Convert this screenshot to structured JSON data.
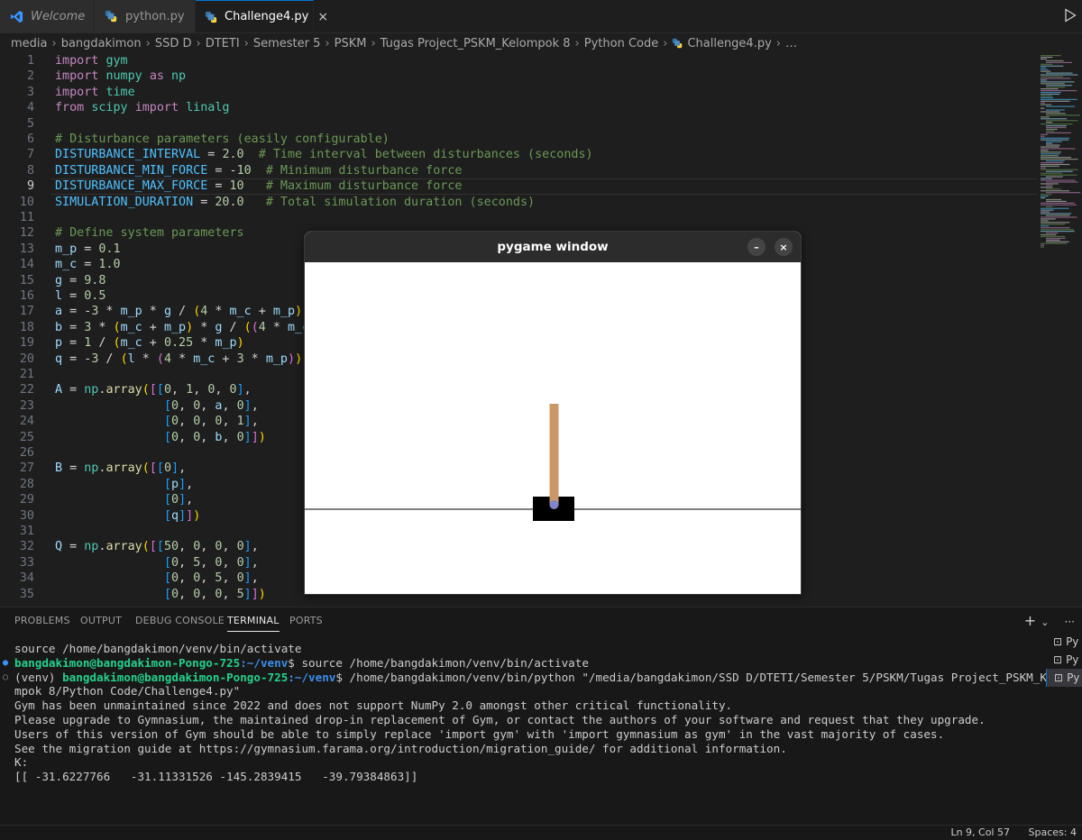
{
  "tabs": [
    {
      "label": "Welcome"
    },
    {
      "label": "python.py"
    },
    {
      "label": "Challenge4.py",
      "close": "×"
    }
  ],
  "breadcrumb": [
    "media",
    "bangdakimon",
    "SSD D",
    "DTETI",
    "Semester 5",
    "PSKM",
    "Tugas Project_PSKM_Kelompok 8",
    "Python Code",
    "Challenge4.py",
    "…"
  ],
  "code_lines": [
    {
      "n": "1"
    },
    {
      "n": "2"
    },
    {
      "n": "3"
    },
    {
      "n": "4"
    },
    {
      "n": "5"
    },
    {
      "n": "6"
    },
    {
      "n": "7"
    },
    {
      "n": "8"
    },
    {
      "n": "9"
    },
    {
      "n": "10"
    },
    {
      "n": "11"
    },
    {
      "n": "12"
    },
    {
      "n": "13"
    },
    {
      "n": "14"
    },
    {
      "n": "15"
    },
    {
      "n": "16"
    },
    {
      "n": "17"
    },
    {
      "n": "18"
    },
    {
      "n": "19"
    },
    {
      "n": "20"
    },
    {
      "n": "21"
    },
    {
      "n": "22"
    },
    {
      "n": "23"
    },
    {
      "n": "24"
    },
    {
      "n": "25"
    },
    {
      "n": "26"
    },
    {
      "n": "27"
    },
    {
      "n": "28"
    },
    {
      "n": "29"
    },
    {
      "n": "30"
    },
    {
      "n": "31"
    },
    {
      "n": "32"
    },
    {
      "n": "33"
    },
    {
      "n": "34"
    },
    {
      "n": "35"
    }
  ],
  "code": [
    [
      [
        "kw",
        "import"
      ],
      [
        "op",
        " "
      ],
      [
        "mod",
        "gym"
      ]
    ],
    [
      [
        "kw",
        "import"
      ],
      [
        "op",
        " "
      ],
      [
        "mod",
        "numpy"
      ],
      [
        "op",
        " "
      ],
      [
        "kw",
        "as"
      ],
      [
        "op",
        " "
      ],
      [
        "mod",
        "np"
      ]
    ],
    [
      [
        "kw",
        "import"
      ],
      [
        "op",
        " "
      ],
      [
        "mod",
        "time"
      ]
    ],
    [
      [
        "kw",
        "from"
      ],
      [
        "op",
        " "
      ],
      [
        "mod",
        "scipy"
      ],
      [
        "op",
        " "
      ],
      [
        "kw",
        "import"
      ],
      [
        "op",
        " "
      ],
      [
        "mod",
        "linalg"
      ]
    ],
    [],
    [
      [
        "cmt",
        "# Disturbance parameters (easily configurable)"
      ]
    ],
    [
      [
        "const",
        "DISTURBANCE_INTERVAL"
      ],
      [
        "op",
        " = "
      ],
      [
        "num",
        "2.0"
      ],
      [
        "op",
        "  "
      ],
      [
        "cmt",
        "# Time interval between disturbances (seconds)"
      ]
    ],
    [
      [
        "const",
        "DISTURBANCE_MIN_FORCE"
      ],
      [
        "op",
        " = -"
      ],
      [
        "num",
        "10"
      ],
      [
        "op",
        "  "
      ],
      [
        "cmt",
        "# Minimum disturbance force"
      ]
    ],
    [
      [
        "const",
        "DISTURBANCE_MAX_FORCE"
      ],
      [
        "op",
        " = "
      ],
      [
        "num",
        "10"
      ],
      [
        "op",
        "   "
      ],
      [
        "cmt",
        "# Maximum disturbance force"
      ]
    ],
    [
      [
        "const",
        "SIMULATION_DURATION"
      ],
      [
        "op",
        " = "
      ],
      [
        "num",
        "20.0"
      ],
      [
        "op",
        "   "
      ],
      [
        "cmt",
        "# Total simulation duration (seconds)"
      ]
    ],
    [],
    [
      [
        "cmt",
        "# Define system parameters"
      ]
    ],
    [
      [
        "var",
        "m_p"
      ],
      [
        "op",
        " = "
      ],
      [
        "num",
        "0.1"
      ]
    ],
    [
      [
        "var",
        "m_c"
      ],
      [
        "op",
        " = "
      ],
      [
        "num",
        "1.0"
      ]
    ],
    [
      [
        "var",
        "g"
      ],
      [
        "op",
        " = "
      ],
      [
        "num",
        "9.8"
      ]
    ],
    [
      [
        "var",
        "l"
      ],
      [
        "op",
        " = "
      ],
      [
        "num",
        "0.5"
      ]
    ],
    [
      [
        "var",
        "a"
      ],
      [
        "op",
        " = -"
      ],
      [
        "num",
        "3"
      ],
      [
        "op",
        " * "
      ],
      [
        "var",
        "m_p"
      ],
      [
        "op",
        " * "
      ],
      [
        "var",
        "g"
      ],
      [
        "op",
        " / "
      ],
      [
        "p1",
        "("
      ],
      [
        "num",
        "4"
      ],
      [
        "op",
        " * "
      ],
      [
        "var",
        "m_c"
      ],
      [
        "op",
        " + "
      ],
      [
        "var",
        "m_p"
      ],
      [
        "p1",
        ")"
      ]
    ],
    [
      [
        "var",
        "b"
      ],
      [
        "op",
        " = "
      ],
      [
        "num",
        "3"
      ],
      [
        "op",
        " * "
      ],
      [
        "p1",
        "("
      ],
      [
        "var",
        "m_c"
      ],
      [
        "op",
        " + "
      ],
      [
        "var",
        "m_p"
      ],
      [
        "p1",
        ")"
      ],
      [
        "op",
        " * "
      ],
      [
        "var",
        "g"
      ],
      [
        "op",
        " / "
      ],
      [
        "p1",
        "("
      ],
      [
        "p2",
        "("
      ],
      [
        "num",
        "4"
      ],
      [
        "op",
        " * "
      ],
      [
        "var",
        "m_c"
      ]
    ],
    [
      [
        "var",
        "p"
      ],
      [
        "op",
        " = "
      ],
      [
        "num",
        "1"
      ],
      [
        "op",
        " / "
      ],
      [
        "p1",
        "("
      ],
      [
        "var",
        "m_c"
      ],
      [
        "op",
        " + "
      ],
      [
        "num",
        "0.25"
      ],
      [
        "op",
        " * "
      ],
      [
        "var",
        "m_p"
      ],
      [
        "p1",
        ")"
      ]
    ],
    [
      [
        "var",
        "q"
      ],
      [
        "op",
        " = -"
      ],
      [
        "num",
        "3"
      ],
      [
        "op",
        " / "
      ],
      [
        "p1",
        "("
      ],
      [
        "var",
        "l"
      ],
      [
        "op",
        " * "
      ],
      [
        "p2",
        "("
      ],
      [
        "num",
        "4"
      ],
      [
        "op",
        " * "
      ],
      [
        "var",
        "m_c"
      ],
      [
        "op",
        " + "
      ],
      [
        "num",
        "3"
      ],
      [
        "op",
        " * "
      ],
      [
        "var",
        "m_p"
      ],
      [
        "p2",
        ")"
      ],
      [
        "p1",
        ")"
      ]
    ],
    [],
    [
      [
        "var",
        "A"
      ],
      [
        "op",
        " = "
      ],
      [
        "mod",
        "np"
      ],
      [
        "op",
        "."
      ],
      [
        "fn",
        "array"
      ],
      [
        "p1",
        "("
      ],
      [
        "p2",
        "["
      ],
      [
        "p3",
        "["
      ],
      [
        "num",
        "0"
      ],
      [
        "op",
        ", "
      ],
      [
        "num",
        "1"
      ],
      [
        "op",
        ", "
      ],
      [
        "num",
        "0"
      ],
      [
        "op",
        ", "
      ],
      [
        "num",
        "0"
      ],
      [
        "p3",
        "]"
      ],
      [
        "op",
        ","
      ]
    ],
    [
      [
        "op",
        "               "
      ],
      [
        "p3",
        "["
      ],
      [
        "num",
        "0"
      ],
      [
        "op",
        ", "
      ],
      [
        "num",
        "0"
      ],
      [
        "op",
        ", "
      ],
      [
        "var",
        "a"
      ],
      [
        "op",
        ", "
      ],
      [
        "num",
        "0"
      ],
      [
        "p3",
        "]"
      ],
      [
        "op",
        ","
      ]
    ],
    [
      [
        "op",
        "               "
      ],
      [
        "p3",
        "["
      ],
      [
        "num",
        "0"
      ],
      [
        "op",
        ", "
      ],
      [
        "num",
        "0"
      ],
      [
        "op",
        ", "
      ],
      [
        "num",
        "0"
      ],
      [
        "op",
        ", "
      ],
      [
        "num",
        "1"
      ],
      [
        "p3",
        "]"
      ],
      [
        "op",
        ","
      ]
    ],
    [
      [
        "op",
        "               "
      ],
      [
        "p3",
        "["
      ],
      [
        "num",
        "0"
      ],
      [
        "op",
        ", "
      ],
      [
        "num",
        "0"
      ],
      [
        "op",
        ", "
      ],
      [
        "var",
        "b"
      ],
      [
        "op",
        ", "
      ],
      [
        "num",
        "0"
      ],
      [
        "p3",
        "]"
      ],
      [
        "p2",
        "]"
      ],
      [
        "p1",
        ")"
      ]
    ],
    [],
    [
      [
        "var",
        "B"
      ],
      [
        "op",
        " = "
      ],
      [
        "mod",
        "np"
      ],
      [
        "op",
        "."
      ],
      [
        "fn",
        "array"
      ],
      [
        "p1",
        "("
      ],
      [
        "p2",
        "["
      ],
      [
        "p3",
        "["
      ],
      [
        "num",
        "0"
      ],
      [
        "p3",
        "]"
      ],
      [
        "op",
        ","
      ]
    ],
    [
      [
        "op",
        "               "
      ],
      [
        "p3",
        "["
      ],
      [
        "var",
        "p"
      ],
      [
        "p3",
        "]"
      ],
      [
        "op",
        ","
      ]
    ],
    [
      [
        "op",
        "               "
      ],
      [
        "p3",
        "["
      ],
      [
        "num",
        "0"
      ],
      [
        "p3",
        "]"
      ],
      [
        "op",
        ","
      ]
    ],
    [
      [
        "op",
        "               "
      ],
      [
        "p3",
        "["
      ],
      [
        "var",
        "q"
      ],
      [
        "p3",
        "]"
      ],
      [
        "p2",
        "]"
      ],
      [
        "p1",
        ")"
      ]
    ],
    [],
    [
      [
        "var",
        "Q"
      ],
      [
        "op",
        " = "
      ],
      [
        "mod",
        "np"
      ],
      [
        "op",
        "."
      ],
      [
        "fn",
        "array"
      ],
      [
        "p1",
        "("
      ],
      [
        "p2",
        "["
      ],
      [
        "p3",
        "["
      ],
      [
        "num",
        "50"
      ],
      [
        "op",
        ", "
      ],
      [
        "num",
        "0"
      ],
      [
        "op",
        ", "
      ],
      [
        "num",
        "0"
      ],
      [
        "op",
        ", "
      ],
      [
        "num",
        "0"
      ],
      [
        "p3",
        "]"
      ],
      [
        "op",
        ","
      ]
    ],
    [
      [
        "op",
        "               "
      ],
      [
        "p3",
        "["
      ],
      [
        "num",
        "0"
      ],
      [
        "op",
        ", "
      ],
      [
        "num",
        "5"
      ],
      [
        "op",
        ", "
      ],
      [
        "num",
        "0"
      ],
      [
        "op",
        ", "
      ],
      [
        "num",
        "0"
      ],
      [
        "p3",
        "]"
      ],
      [
        "op",
        ","
      ]
    ],
    [
      [
        "op",
        "               "
      ],
      [
        "p3",
        "["
      ],
      [
        "num",
        "0"
      ],
      [
        "op",
        ", "
      ],
      [
        "num",
        "0"
      ],
      [
        "op",
        ", "
      ],
      [
        "num",
        "5"
      ],
      [
        "op",
        ", "
      ],
      [
        "num",
        "0"
      ],
      [
        "p3",
        "]"
      ],
      [
        "op",
        ","
      ]
    ],
    [
      [
        "op",
        "               "
      ],
      [
        "p3",
        "["
      ],
      [
        "num",
        "0"
      ],
      [
        "op",
        ", "
      ],
      [
        "num",
        "0"
      ],
      [
        "op",
        ", "
      ],
      [
        "num",
        "0"
      ],
      [
        "op",
        ", "
      ],
      [
        "num",
        "5"
      ],
      [
        "p3",
        "]"
      ],
      [
        "p2",
        "]"
      ],
      [
        "p1",
        ")"
      ]
    ]
  ],
  "current_line": 9,
  "pygame": {
    "title": "pygame window",
    "minimize": "–",
    "close": "×"
  },
  "panel": {
    "tabs": [
      "PROBLEMS",
      "OUTPUT",
      "DEBUG CONSOLE",
      "TERMINAL",
      "PORTS"
    ],
    "active_tab": "TERMINAL",
    "actions": {
      "add": "+",
      "chevron": "⌄",
      "more": "···"
    }
  },
  "terminal": {
    "line1": "source /home/bangdakimon/venv/bin/activate",
    "prompt_user": "bangdakimon@bangdakimon-Pongo-725",
    "prompt_path": ":~/venv",
    "prompt_symbol": "$",
    "cmd1": " source /home/bangdakimon/venv/bin/activate",
    "venv_prefix": "(venv) ",
    "cmd2": " /home/bangdakimon/venv/bin/python \"/media/bangdakimon/SSD D/DTETI/Semester 5/PSKM/Tugas Project_PSKM_Kelo",
    "cmd2_cont": "mpok 8/Python Code/Challenge4.py\"",
    "out1": "Gym has been unmaintained since 2022 and does not support NumPy 2.0 amongst other critical functionality.",
    "out2": "Please upgrade to Gymnasium, the maintained drop-in replacement of Gym, or contact the authors of your software and request that they upgrade.",
    "out3": "Users of this version of Gym should be able to simply replace 'import gym' with 'import gymnasium as gym' in the vast majority of cases.",
    "out4": "See the migration guide at https://gymnasium.farama.org/introduction/migration_guide/ for additional information.",
    "out5": "K:",
    "out6": "[[ -31.6227766   -31.11331526 -145.2839415   -39.79384863]]"
  },
  "term_list": [
    "Py",
    "Py",
    "Py"
  ],
  "status": {
    "position": "Ln 9, Col 57",
    "spaces": "Spaces: 4"
  },
  "colors": {
    "accent": "#0078d4",
    "cart": "#000000",
    "pole": "#ca9865",
    "axle": "#8184cb"
  }
}
